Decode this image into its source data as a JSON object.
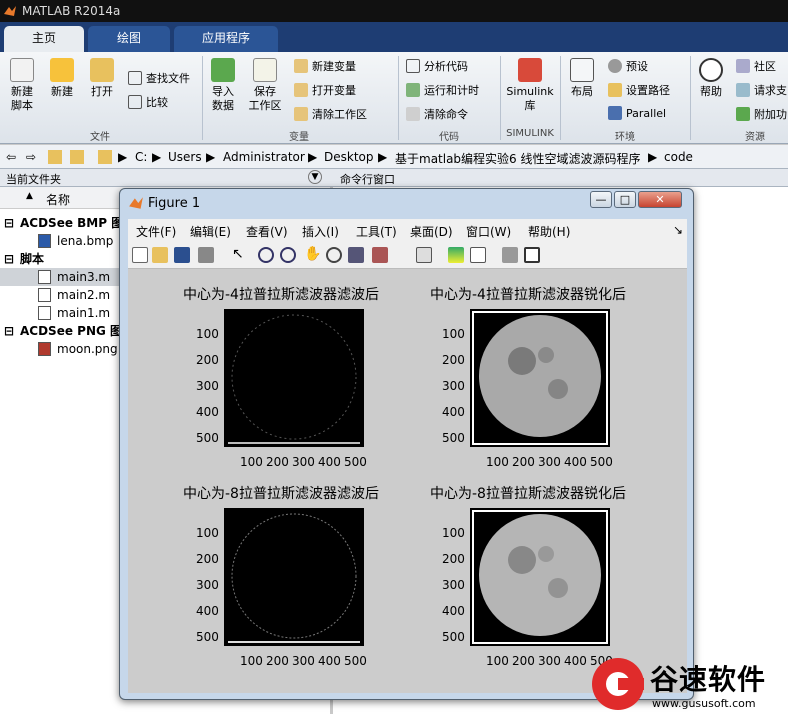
{
  "app": {
    "title": "MATLAB R2014a"
  },
  "tabs": [
    "主页",
    "绘图",
    "应用程序"
  ],
  "ribbon": {
    "new_script": "新建\n脚本",
    "new": "新建",
    "open": "打开",
    "find_files": "查找文件",
    "compare": "比较",
    "import_data": "导入\n数据",
    "save_workspace": "保存\n工作区",
    "new_variable": "新建变量",
    "open_variable": "打开变量",
    "clear_workspace": "清除工作区",
    "analyze_code": "分析代码",
    "run_and_time": "运行和计时",
    "clear_commands": "清除命令",
    "simulink": "Simulink\n库",
    "layout": "布局",
    "preferences": "预设",
    "set_path": "设置路径",
    "parallel": "Parallel",
    "help": "帮助",
    "community": "社区",
    "request_support": "请求支",
    "addons": "附加功",
    "sections": [
      "文件",
      "变量",
      "代码",
      "SIMULINK",
      "环境",
      "资源"
    ]
  },
  "address": [
    "C:",
    "Users",
    "Administrator",
    "Desktop",
    "基于matlab编程实验6  线性空域滤波源码程序",
    "code"
  ],
  "panes": {
    "current_folder": "当前文件夹",
    "command_window": "命令行窗口",
    "name_col": "名称"
  },
  "files": [
    {
      "group": "ACDSee BMP 图像",
      "items": [
        "lena.bmp"
      ]
    },
    {
      "group": "脚本",
      "items": [
        "main3.m",
        "main2.m",
        "main1.m"
      ]
    },
    {
      "group": "ACDSee PNG 图像",
      "items": [
        "moon.png"
      ]
    }
  ],
  "figure": {
    "title": "Figure 1",
    "menu": [
      "文件(F)",
      "编辑(E)",
      "查看(V)",
      "插入(I)",
      "工具(T)",
      "桌面(D)",
      "窗口(W)",
      "帮助(H)"
    ],
    "plots": [
      {
        "title": "中心为-4拉普拉斯滤波器滤波后"
      },
      {
        "title": "中心为-4拉普拉斯滤波器锐化后"
      },
      {
        "title": "中心为-8拉普拉斯滤波器滤波后"
      },
      {
        "title": "中心为-8拉普拉斯滤波器锐化后"
      }
    ],
    "yticks": [
      "100",
      "200",
      "300",
      "400",
      "500"
    ],
    "xticks": [
      "100",
      "200",
      "300",
      "400",
      "500"
    ]
  },
  "watermark": {
    "brand": "谷速软件",
    "url": "www.gususoft.com"
  }
}
